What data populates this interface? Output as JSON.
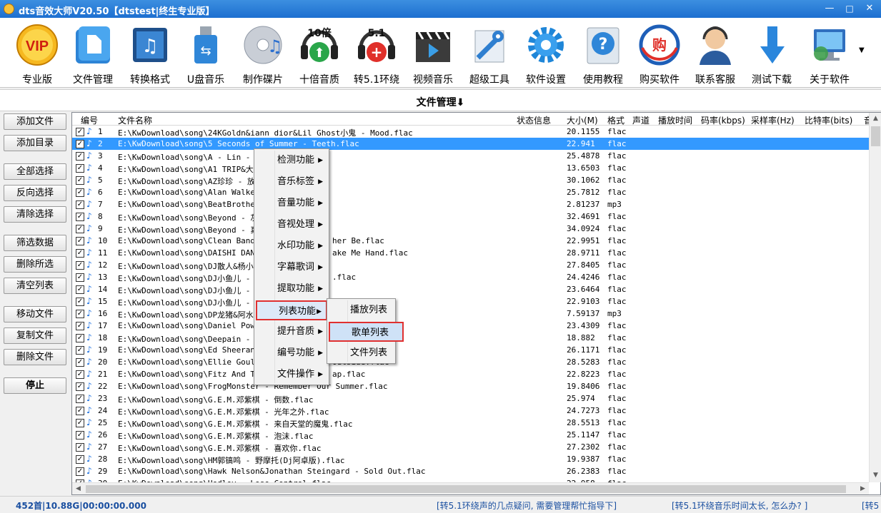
{
  "window": {
    "title": "dts音效大师V20.50【dtstest|终生专业版】",
    "minimize": "—",
    "maximize": "□",
    "close": "✕"
  },
  "toolbar": [
    {
      "label": "专业版",
      "icon": "vip-icon",
      "badge": "VIP"
    },
    {
      "label": "文件管理",
      "icon": "file-manager-icon"
    },
    {
      "label": "转换格式",
      "icon": "convert-format-icon"
    },
    {
      "label": "U盘音乐",
      "icon": "usb-drive-icon"
    },
    {
      "label": "制作碟片",
      "icon": "disc-icon"
    },
    {
      "label": "十倍音质",
      "icon": "headphones-10x-icon",
      "badge": "10倍"
    },
    {
      "label": "转5.1环绕",
      "icon": "headphones-51-icon",
      "badge": "5.1"
    },
    {
      "label": "视频音乐",
      "icon": "video-clapper-icon"
    },
    {
      "label": "超级工具",
      "icon": "tools-icon"
    },
    {
      "label": "软件设置",
      "icon": "settings-gear-icon"
    },
    {
      "label": "使用教程",
      "icon": "help-icon"
    },
    {
      "label": "购买软件",
      "icon": "buy-icon",
      "badge": "购"
    },
    {
      "label": "联系客服",
      "icon": "customer-service-icon"
    },
    {
      "label": "测试下载",
      "icon": "download-arrow-icon"
    },
    {
      "label": "关于软件",
      "icon": "about-computer-icon"
    }
  ],
  "panel": {
    "title": "文件管理⬇"
  },
  "left_buttons": [
    "添加文件",
    "添加目录",
    "全部选择",
    "反向选择",
    "清除选择",
    "筛选数据",
    "删除所选",
    "清空列表",
    "移动文件",
    "复制文件",
    "删除文件",
    "停止"
  ],
  "columns": [
    "编号",
    "文件名称",
    "状态信息",
    "大小(M)",
    "格式",
    "声道",
    "播放时间",
    "码率(kbps)",
    "采样率(Hz)",
    "比特率(bits)",
    "音"
  ],
  "rows": [
    {
      "num": "1",
      "name": "E:\\KwDownload\\song\\24KGoldn&iann dior&Lil Ghost小鬼 - Mood.flac",
      "size": "20.1155",
      "fmt": "flac"
    },
    {
      "num": "2",
      "name": "E:\\KwDownload\\song\\5 Seconds of Summer - Teeth.flac",
      "size": "22.941",
      "fmt": "flac",
      "selected": true
    },
    {
      "num": "3",
      "name": "E:\\KwDownload\\song\\A - Lin - 天天",
      "size": "25.4878",
      "fmt": "flac"
    },
    {
      "num": "4",
      "name": "E:\\KwDownload\\song\\A1 TRIP&大籽&",
      "size": "13.6503",
      "fmt": "flac"
    },
    {
      "num": "5",
      "name": "E:\\KwDownload\\song\\AZ珍珍 - 放不",
      "size": "30.1062",
      "fmt": "flac"
    },
    {
      "num": "6",
      "name": "E:\\KwDownload\\song\\Alan Walker -",
      "size": "25.7812",
      "fmt": "flac"
    },
    {
      "num": "7",
      "name": "E:\\KwDownload\\song\\BeatBrothers-",
      "size": "2.81237",
      "fmt": "mp3"
    },
    {
      "num": "8",
      "name": "E:\\KwDownload\\song\\Beyond - 灰色",
      "size": "32.4691",
      "fmt": "flac"
    },
    {
      "num": "9",
      "name": "E:\\KwDownload\\song\\Beyond - 真的",
      "size": "34.0924",
      "fmt": "flac"
    },
    {
      "num": "10",
      "name": "E:\\KwDownload\\song\\Clean Bandit&",
      "tail": "her Be.flac",
      "size": "22.9951",
      "fmt": "flac"
    },
    {
      "num": "11",
      "name": "E:\\KwDownload\\song\\DAISHI DANCE&",
      "tail": "ake Me Hand.flac",
      "size": "28.9711",
      "fmt": "flac"
    },
    {
      "num": "12",
      "name": "E:\\KwDownload\\song\\DJ散人&杨小壮",
      "size": "27.8405",
      "fmt": "flac"
    },
    {
      "num": "13",
      "name": "E:\\KwDownload\\song\\DJ小鱼儿 - 她",
      "tail": ".flac",
      "size": "24.4246",
      "fmt": "flac"
    },
    {
      "num": "14",
      "name": "E:\\KwDownload\\song\\DJ小鱼儿 - 夜",
      "size": "23.6464",
      "fmt": "flac"
    },
    {
      "num": "15",
      "name": "E:\\KwDownload\\song\\DJ小鱼儿 -",
      "size": "22.9103",
      "fmt": "flac"
    },
    {
      "num": "16",
      "name": "E:\\KwDownload\\song\\DP龙猪&阿水&",
      "size": "7.59137",
      "fmt": "mp3"
    },
    {
      "num": "17",
      "name": "E:\\KwDownload\\song\\Daniel Powter",
      "size": "23.4309",
      "fmt": "flac"
    },
    {
      "num": "18",
      "name": "E:\\KwDownload\\song\\Deepain - 身",
      "size": "18.882",
      "fmt": "flac"
    },
    {
      "num": "19",
      "name": "E:\\KwDownload\\song\\Ed Sheeran -",
      "size": "26.1171",
      "fmt": "flac"
    },
    {
      "num": "20",
      "name": "E:\\KwDownload\\song\\Ellie Gouldir",
      "tail": "Outside.flac",
      "size": "28.5283",
      "fmt": "flac"
    },
    {
      "num": "21",
      "name": "E:\\KwDownload\\song\\Fitz And The",
      "tail": "ap.flac",
      "size": "22.8223",
      "fmt": "flac"
    },
    {
      "num": "22",
      "name": "E:\\KwDownload\\song\\FrogMonster - Remember Our Summer.flac",
      "size": "19.8406",
      "fmt": "flac"
    },
    {
      "num": "23",
      "name": "E:\\KwDownload\\song\\G.E.M.邓紫棋 - 倒数.flac",
      "size": "25.974",
      "fmt": "flac"
    },
    {
      "num": "24",
      "name": "E:\\KwDownload\\song\\G.E.M.邓紫棋 - 光年之外.flac",
      "size": "24.7273",
      "fmt": "flac"
    },
    {
      "num": "25",
      "name": "E:\\KwDownload\\song\\G.E.M.邓紫棋 - 来自天堂的魔鬼.flac",
      "size": "28.5513",
      "fmt": "flac"
    },
    {
      "num": "26",
      "name": "E:\\KwDownload\\song\\G.E.M.邓紫棋 - 泡沫.flac",
      "size": "25.1147",
      "fmt": "flac"
    },
    {
      "num": "27",
      "name": "E:\\KwDownload\\song\\G.E.M.邓紫棋 - 喜欢你.flac",
      "size": "27.2302",
      "fmt": "flac"
    },
    {
      "num": "28",
      "name": "E:\\KwDownload\\song\\HM郭镐鸣 - 野摩托(Dj阿卓版).flac",
      "size": "19.9387",
      "fmt": "flac"
    },
    {
      "num": "29",
      "name": "E:\\KwDownload\\song\\Hawk Nelson&Jonathan Steingard - Sold Out.flac",
      "size": "26.2383",
      "fmt": "flac"
    },
    {
      "num": "30",
      "name": "E:\\KwDownload\\song\\Hedley - Lose Control.flac",
      "size": "22.958",
      "fmt": "flac"
    }
  ],
  "context_menu": [
    "检测功能",
    "音乐标签",
    "音量功能",
    "音视处理",
    "水印功能",
    "字幕歌词",
    "提取功能",
    "列表功能",
    "提升音质",
    "编号功能",
    "文件操作"
  ],
  "submenu": [
    "播放列表",
    "歌单列表",
    "文件列表"
  ],
  "status": {
    "count": "452首|10.88G|00:00:00.000",
    "link1": "[转5.1环绕声的几点疑问, 需要管理帮忙指导下]",
    "link2": "[转5.1环绕音乐时间太长, 怎么办? ]",
    "link3": "[转5"
  },
  "colors": {
    "accent": "#1d6fd0",
    "selection": "#3399ff",
    "highlight_border": "#e03030",
    "status_text": "#1a4fa0"
  }
}
